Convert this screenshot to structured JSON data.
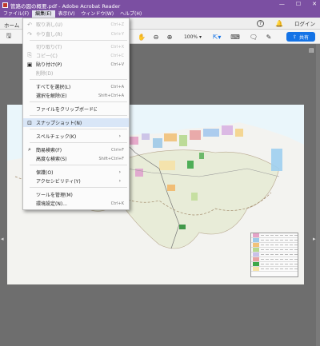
{
  "window": {
    "title": "管路の図の概要.pdf - Adobe Acrobat Reader",
    "controls": [
      "—",
      "☐",
      "✕"
    ]
  },
  "menubar": {
    "items": [
      {
        "label": "ファイル(F)",
        "active": false
      },
      {
        "label": "編集(E)",
        "active": true
      },
      {
        "label": "表示(V)",
        "active": false
      },
      {
        "label": "ウィンドウ(W)",
        "active": false
      },
      {
        "label": "ヘルプ(H)",
        "active": false
      }
    ]
  },
  "tabs": {
    "home": "ホーム",
    "help_icon": "?",
    "bell_icon": "bell-icon",
    "signin": "ログイン"
  },
  "toolbar": {
    "zoom_value": "100%",
    "share_label": "共有"
  },
  "dropdown": {
    "items": [
      {
        "icon": "↶",
        "label": "取り消し(U)",
        "shortcut": "Ctrl+Z",
        "disabled": true,
        "submenu": false
      },
      {
        "icon": "↷",
        "label": "やり直し(R)",
        "shortcut": "Ctrl+Y",
        "disabled": true,
        "submenu": false
      },
      {
        "icon": "",
        "label": "切り取り(T)",
        "shortcut": "Ctrl+X",
        "disabled": true,
        "submenu": false
      },
      {
        "icon": "⎘",
        "label": "コピー(C)",
        "shortcut": "Ctrl+C",
        "disabled": true,
        "submenu": false
      },
      {
        "icon": "▣",
        "label": "貼り付け(P)",
        "shortcut": "Ctrl+V",
        "disabled": false,
        "submenu": false
      },
      {
        "icon": "",
        "label": "削除(D)",
        "shortcut": "",
        "disabled": true,
        "submenu": false
      },
      {
        "icon": "",
        "label": "すべてを選択(L)",
        "shortcut": "Ctrl+A",
        "disabled": false,
        "submenu": false
      },
      {
        "icon": "",
        "label": "選択を解除(E)",
        "shortcut": "Shift+Ctrl+A",
        "disabled": false,
        "submenu": false
      },
      {
        "icon": "",
        "label": "ファイルをクリップボードにコピー(Y)",
        "shortcut": "",
        "disabled": false,
        "submenu": false
      },
      {
        "icon": "⊡",
        "label": "スナップショット(N)",
        "shortcut": "",
        "disabled": false,
        "submenu": false,
        "highlight": true
      },
      {
        "icon": "",
        "label": "スペルチェック(K)",
        "shortcut": "",
        "disabled": false,
        "submenu": true
      },
      {
        "icon": "⌕",
        "label": "簡易検索(F)",
        "shortcut": "Ctrl+F",
        "disabled": false,
        "submenu": false
      },
      {
        "icon": "",
        "label": "高度な検索(S)",
        "shortcut": "Shift+Ctrl+F",
        "disabled": false,
        "submenu": false
      },
      {
        "icon": "",
        "label": "保護(O)",
        "shortcut": "",
        "disabled": false,
        "submenu": true
      },
      {
        "icon": "",
        "label": "アクセシビリティ(Y)",
        "shortcut": "",
        "disabled": false,
        "submenu": true
      },
      {
        "icon": "",
        "label": "ツールを管理(M)",
        "shortcut": "",
        "disabled": false,
        "submenu": false
      },
      {
        "icon": "",
        "label": "環境設定(N)...",
        "shortcut": "Ctrl+K",
        "disabled": false,
        "submenu": false
      }
    ]
  },
  "colors": {
    "titlebar": "#7b4fa2",
    "share_button": "#1473e6",
    "highlight": "#d9e6f7"
  }
}
